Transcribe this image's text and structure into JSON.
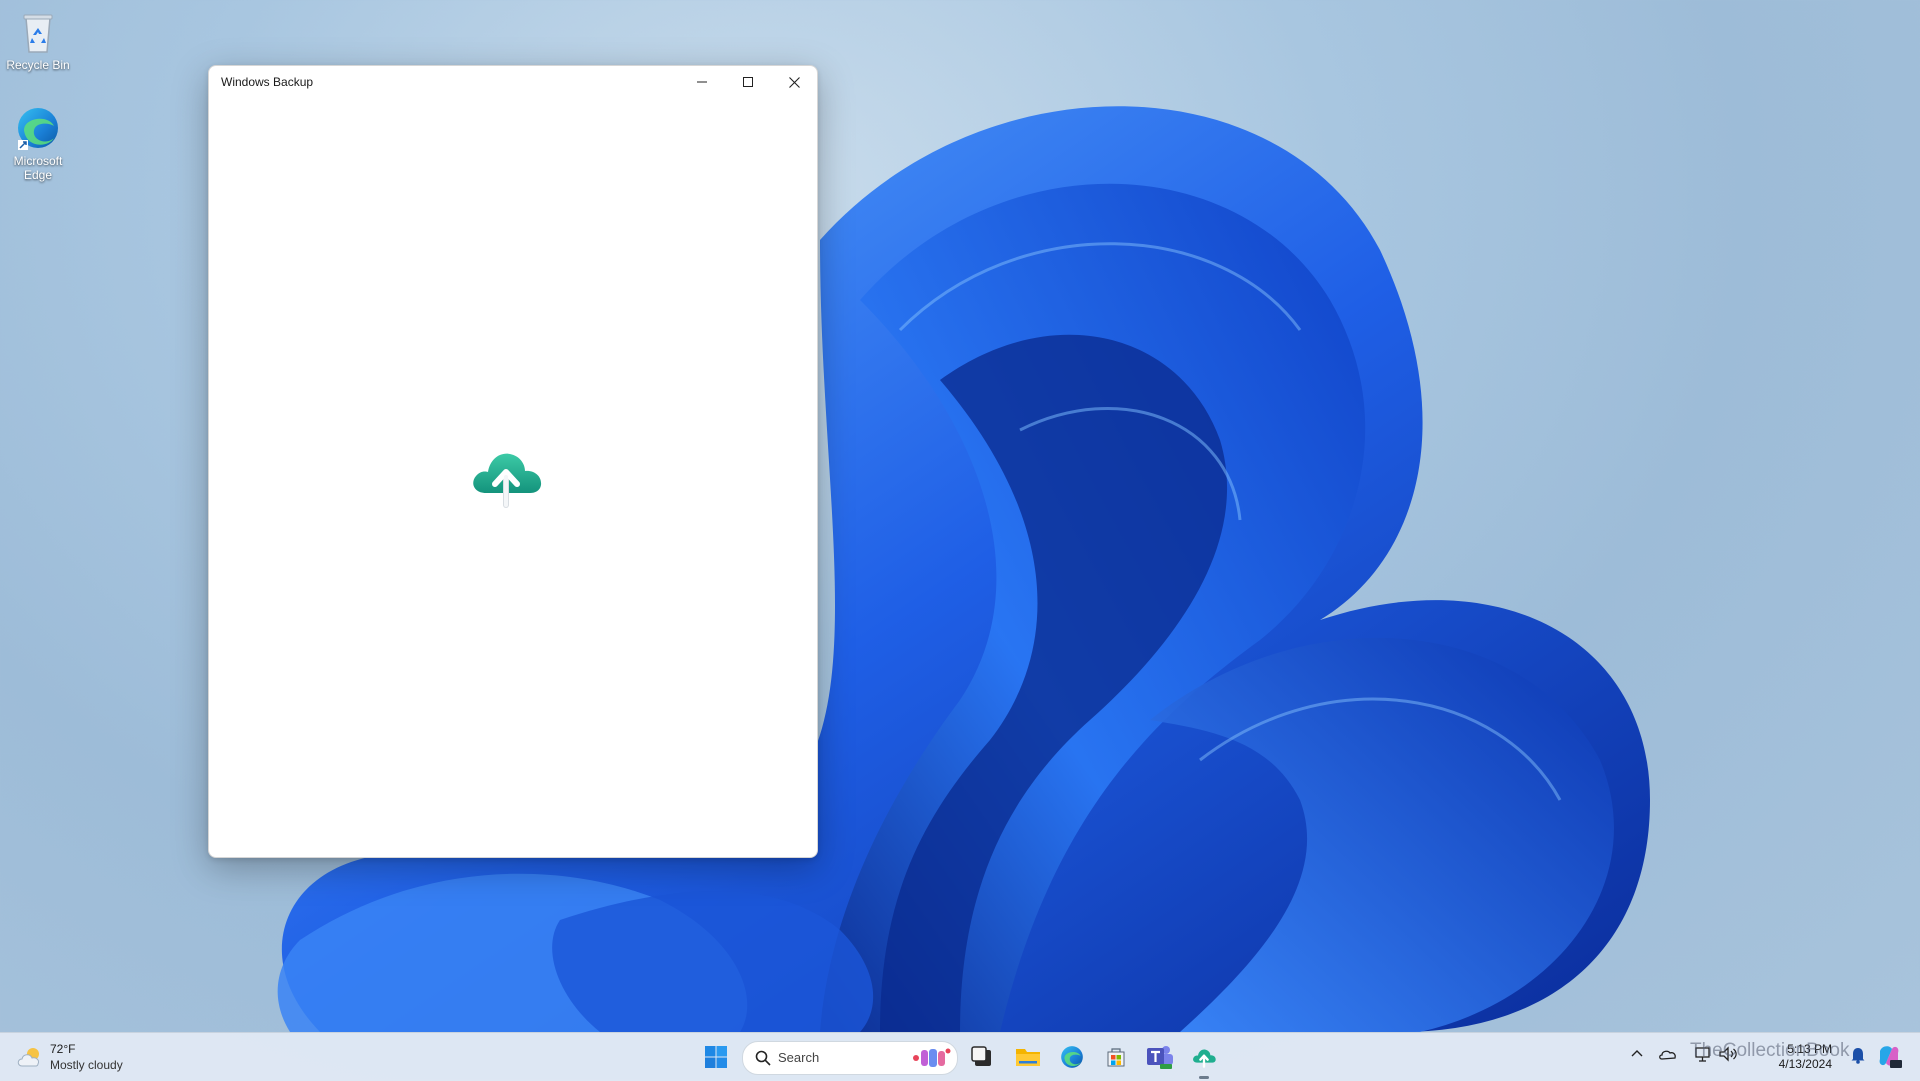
{
  "desktop": {
    "icons": [
      {
        "label": "Recycle Bin",
        "icon": "recycle-bin-icon"
      },
      {
        "label": "Microsoft Edge",
        "icon": "edge-icon"
      }
    ]
  },
  "window": {
    "title": "Windows Backup",
    "controls": {
      "minimize": "minimize-icon",
      "maximize": "maximize-icon",
      "close": "close-icon"
    },
    "splash_icon": "cloud-upload-icon",
    "accent_color": "#1fae8f"
  },
  "taskbar": {
    "weather": {
      "temp": "72°F",
      "desc": "Mostly cloudy",
      "icon": "partly-cloudy-icon"
    },
    "search": {
      "label": "Search"
    },
    "pinned": [
      "start-icon",
      "task-view-icon",
      "file-explorer-icon",
      "edge-icon",
      "store-icon",
      "teams-icon",
      "windows-backup-icon"
    ],
    "tray": {
      "time": "5:13 PM",
      "date": "4/13/2024"
    }
  },
  "watermark": "TheCollectionBook"
}
